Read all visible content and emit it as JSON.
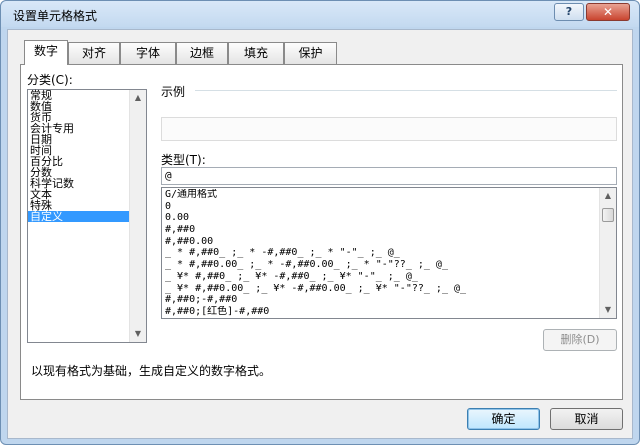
{
  "window": {
    "title": "设置单元格格式",
    "help_label": "?",
    "close_label": "✕"
  },
  "tabs": [
    {
      "label": "数字",
      "active": true
    },
    {
      "label": "对齐",
      "active": false
    },
    {
      "label": "字体",
      "active": false
    },
    {
      "label": "边框",
      "active": false
    },
    {
      "label": "填充",
      "active": false
    },
    {
      "label": "保护",
      "active": false
    }
  ],
  "category": {
    "label": "分类(C):",
    "items": [
      "常规",
      "数值",
      "货币",
      "会计专用",
      "日期",
      "时间",
      "百分比",
      "分数",
      "科学记数",
      "文本",
      "特殊",
      "自定义"
    ],
    "selected": "自定义"
  },
  "sample": {
    "label": "示例",
    "value": ""
  },
  "type": {
    "label": "类型(T):",
    "value": "@",
    "formats": [
      "G/通用格式",
      "0",
      "0.00",
      "#,##0",
      "#,##0.00",
      "_ * #,##0_ ;_ * -#,##0_ ;_ * \"-\"_ ;_ @_",
      "_ * #,##0.00_ ;_ * -#,##0.00_ ;_ * \"-\"??_ ;_ @_",
      "_ ¥* #,##0_ ;_ ¥* -#,##0_ ;_ ¥* \"-\"_ ;_ @_",
      "_ ¥* #,##0.00_ ;_ ¥* -#,##0.00_ ;_ ¥* \"-\"??_ ;_ @_",
      "#,##0;-#,##0",
      "#,##0;[红色]-#,##0"
    ]
  },
  "buttons": {
    "delete": "删除(D)",
    "ok": "确定",
    "cancel": "取消"
  },
  "description": "以现有格式为基础，生成自定义的数字格式。"
}
